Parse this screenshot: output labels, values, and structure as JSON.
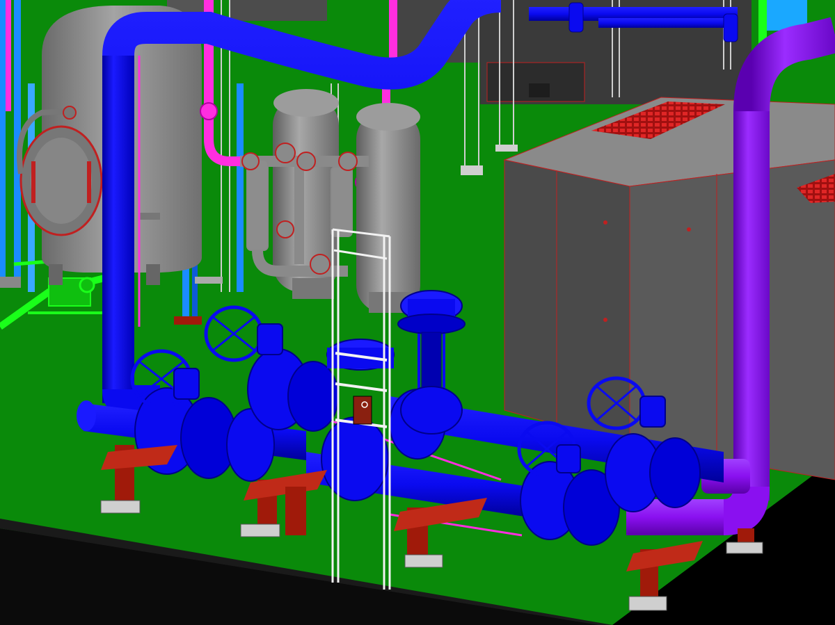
{
  "view": {
    "kind": "3D piping model render",
    "background": "#000000",
    "floor_color": "#0a8a0a",
    "floor_edge_color": "#0e0e0e"
  },
  "colors": {
    "main_pipe": "#0a0af0",
    "main_pipe_shade": "#0000a8",
    "purple_pipe": "#8a10f0",
    "purple_pipe_shade": "#5a00b0",
    "magenta_pipe": "#ff2ee0",
    "green_pipe": "#1aff1a",
    "cyan_pipe": "#1a8cff",
    "vessel_gray": "#8c8c8c",
    "vessel_shade": "#5e5e5e",
    "equipment_gray": "#7a7a7a",
    "equipment_dark": "#4a4a4a",
    "grating_red": "#d01818",
    "support_red": "#a01a0a",
    "outline_red": "#e02020",
    "ladder_white": "#f2f2f2"
  },
  "equipment": [
    {
      "name": "horizontal-vessel",
      "color": "vessel_gray"
    },
    {
      "name": "twin-filter-vessels",
      "color": "vessel_gray"
    },
    {
      "name": "compressor-enclosure",
      "color": "equipment_gray"
    },
    {
      "name": "control-valve",
      "color": "main_pipe"
    },
    {
      "name": "handwheel-ball-valves",
      "color": "main_pipe"
    },
    {
      "name": "access-ladder",
      "color": "ladder_white"
    },
    {
      "name": "pipe-supports",
      "color": "support_red"
    }
  ]
}
